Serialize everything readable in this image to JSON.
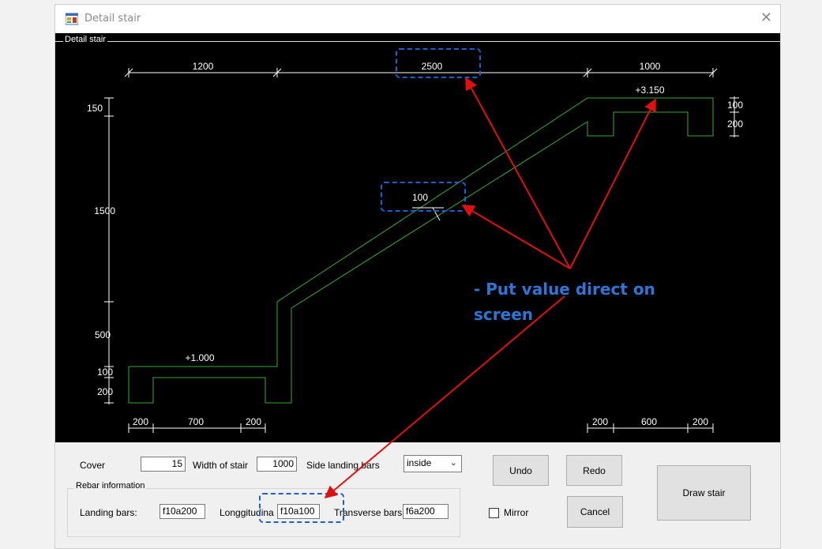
{
  "window": {
    "title": "Detail stair",
    "close_glyph": "✕"
  },
  "drawing": {
    "group_caption": "Detail stair",
    "top_dims": [
      "1200",
      "2500",
      "1000"
    ],
    "left_dims": [
      "150",
      "1500",
      "500",
      "100",
      "200"
    ],
    "right_dims": [
      "100",
      "200"
    ],
    "bottom_dims": [
      "200",
      "700",
      "200",
      "200",
      "600",
      "200"
    ],
    "thickness_dim": "100",
    "upper_level": "+3.150",
    "lower_level": "+1.000",
    "colors": {
      "stair_line": "#39a839",
      "dim_line": "#ffffff",
      "background": "#000000"
    }
  },
  "form": {
    "cover_label": "Cover",
    "cover_value": "15",
    "width_label": "Width of stair",
    "width_value": "1000",
    "side_landing_label": "Side landing bars",
    "side_landing_value": "inside",
    "rebar_group_label": "Rebar information",
    "landing_bars_label": "Landing bars:",
    "landing_bars_value": "f10a200",
    "longitudinal_label": "Longgitudina",
    "longitudinal_value": "f10a100",
    "transverse_label": "Transverse bars",
    "transverse_value": "f6a200",
    "mirror_label": "Mirror",
    "undo_label": "Undo",
    "redo_label": "Redo",
    "cancel_label": "Cancel",
    "draw_label": "Draw stair"
  },
  "annotation": {
    "line1": "- Put value direct on",
    "line2": "screen",
    "color": "#2e75d6",
    "arrow_color": "#e01010"
  }
}
